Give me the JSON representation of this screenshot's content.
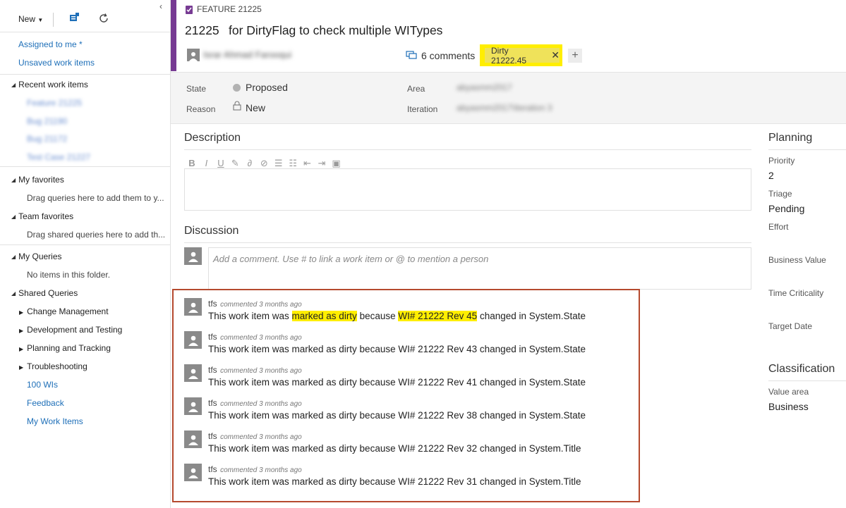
{
  "sidebar": {
    "new_label": "New",
    "queries": [
      "Assigned to me *",
      "Unsaved work items"
    ],
    "recent": {
      "label": "Recent work items",
      "items": [
        "Feature 21225",
        "Bug 21190",
        "Bug 21172",
        "Test Case 21227"
      ]
    },
    "my_favorites": {
      "label": "My favorites",
      "hint": "Drag queries here to add them to y..."
    },
    "team_favorites": {
      "label": "Team favorites",
      "hint": "Drag shared queries here to add th..."
    },
    "my_queries": {
      "label": "My Queries",
      "hint": "No items in this folder."
    },
    "shared_queries": {
      "label": "Shared Queries",
      "folders": [
        "Change Management",
        "Development and Testing",
        "Planning and Tracking",
        "Troubleshooting"
      ],
      "items": [
        "100 WIs",
        "Feedback",
        "My Work Items"
      ]
    }
  },
  "workitem": {
    "type_label": "FEATURE 21225",
    "id": "21225",
    "title": "for DirtyFlag to check multiple WITypes",
    "assigned_to": "Israr Ahmad Farooqui",
    "comments_label": "6 comments",
    "tag": "Dirty 21222.45",
    "fields": {
      "state_label": "State",
      "state_value": "Proposed",
      "reason_label": "Reason",
      "reason_value": "New",
      "area_label": "Area",
      "area_value": "abyasmm2017",
      "iteration_label": "Iteration",
      "iteration_value": "abyasmm2017\\Iteration 3"
    }
  },
  "description": {
    "title": "Description"
  },
  "discussion": {
    "title": "Discussion",
    "placeholder": "Add a comment. Use # to link a work item or @ to mention a person",
    "comments": [
      {
        "author": "tfs",
        "meta": "commented 3 months ago",
        "p1": "This work item was ",
        "h1": "marked as dirty",
        "p2": " because ",
        "h2": "WI# 21222 Rev 45",
        "p3": " changed in System.State"
      },
      {
        "author": "tfs",
        "meta": "commented 3 months ago",
        "text": "This work item was marked as dirty because WI# 21222 Rev 43 changed in System.State"
      },
      {
        "author": "tfs",
        "meta": "commented 3 months ago",
        "text": "This work item was marked as dirty because WI# 21222 Rev 41 changed in System.State"
      },
      {
        "author": "tfs",
        "meta": "commented 3 months ago",
        "text": "This work item was marked as dirty because WI# 21222 Rev 38 changed in System.State"
      },
      {
        "author": "tfs",
        "meta": "commented 3 months ago",
        "text": "This work item was marked as dirty because WI# 21222 Rev 32 changed in System.Title"
      },
      {
        "author": "tfs",
        "meta": "commented 3 months ago",
        "text": "This work item was marked as dirty because WI# 21222 Rev 31 changed in System.Title"
      }
    ]
  },
  "planning": {
    "title": "Planning",
    "priority_label": "Priority",
    "priority_value": "2",
    "triage_label": "Triage",
    "triage_value": "Pending",
    "effort_label": "Effort",
    "business_value_label": "Business Value",
    "time_criticality_label": "Time Criticality",
    "target_date_label": "Target Date"
  },
  "classification": {
    "title": "Classification",
    "value_area_label": "Value area",
    "value_area_value": "Business"
  },
  "colors": {
    "accent_purple": "#773b93",
    "link_blue": "#1e6fb8",
    "highlight": "#ffee00",
    "callout_border": "#b54a2e"
  }
}
